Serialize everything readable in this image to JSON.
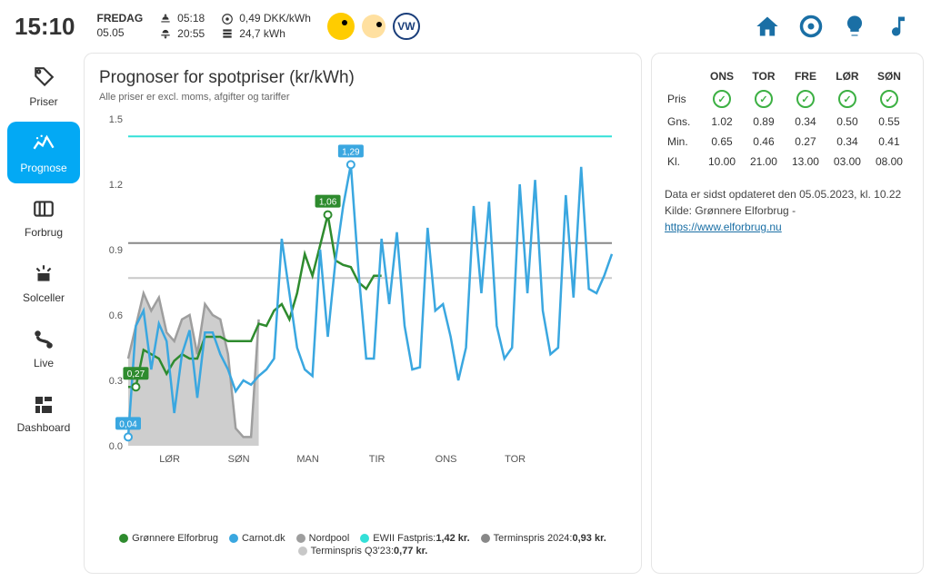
{
  "header": {
    "clock": "15:10",
    "day_name": "FREDAG",
    "date": "05.05",
    "sunrise": "05:18",
    "sunset": "20:55",
    "price_rate": "0,49 DKK/kWh",
    "energy_today": "24,7 kWh"
  },
  "sidebar": {
    "items": [
      {
        "label": "Priser",
        "icon": "tag"
      },
      {
        "label": "Prognose",
        "icon": "sparkline",
        "active": true
      },
      {
        "label": "Forbrug",
        "icon": "counter"
      },
      {
        "label": "Solceller",
        "icon": "solar"
      },
      {
        "label": "Live",
        "icon": "route"
      },
      {
        "label": "Dashboard",
        "icon": "grid"
      }
    ]
  },
  "panel": {
    "title": "Prognoser for spotpriser (kr/kWh)",
    "subtitle": "Alle priser er excl. moms, afgifter og tariffer"
  },
  "legend": [
    {
      "color": "#2e8b2e",
      "label": "Grønnere Elforbrug"
    },
    {
      "color": "#3aa7e0",
      "label": "Carnot.dk"
    },
    {
      "color": "#9e9e9e",
      "label": "Nordpool"
    },
    {
      "color": "#33e0d8",
      "label": "EWII Fastpris:",
      "value": "1,42 kr."
    },
    {
      "color": "#888888",
      "label": "Terminspris 2024:",
      "value": "0,93 kr."
    },
    {
      "color": "#c8c8c8",
      "label": "Terminspris Q3'23:",
      "value": "0,77 kr."
    }
  ],
  "chart_data": {
    "type": "line",
    "title": "Prognoser for spotpriser (kr/kWh)",
    "xlabel": "",
    "ylabel": "",
    "ylim": [
      0,
      1.5
    ],
    "yticks": [
      0.0,
      0.3,
      0.6,
      0.9,
      1.2,
      1.5
    ],
    "x_tick_labels": [
      "LØR",
      "SØN",
      "MAN",
      "TIR",
      "ONS",
      "TOR"
    ],
    "data_labels": [
      {
        "series": "Carnot.dk",
        "x_index": 0,
        "value": 0.04
      },
      {
        "series": "Grønnere Elforbrug",
        "x_index": 1,
        "value": 0.27
      },
      {
        "series": "Grønnere Elforbrug",
        "x_index": 26,
        "value": 1.06
      },
      {
        "series": "Carnot.dk",
        "x_index": 29,
        "value": 1.29
      }
    ],
    "ref_lines": [
      {
        "name": "EWII Fastpris",
        "y": 1.42,
        "color": "#33e0d8"
      },
      {
        "name": "Terminspris 2024",
        "y": 0.93,
        "color": "#888888"
      },
      {
        "name": "Terminspris Q3'23",
        "y": 0.77,
        "color": "#c8c8c8"
      }
    ],
    "series": [
      {
        "name": "Nordpool",
        "color": "#9e9e9e",
        "area": true,
        "values": [
          0.4,
          0.55,
          0.7,
          0.62,
          0.68,
          0.52,
          0.48,
          0.58,
          0.6,
          0.42,
          0.65,
          0.6,
          0.58,
          0.42,
          0.08,
          0.04,
          0.04,
          0.58,
          null,
          null,
          null,
          null,
          null,
          null,
          null,
          null,
          null,
          null,
          null,
          null,
          null,
          null,
          null,
          null,
          null,
          null,
          null,
          null,
          null,
          null,
          null,
          null,
          null,
          null,
          null,
          null,
          null,
          null,
          null,
          null,
          null,
          null,
          null,
          null,
          null,
          null,
          null,
          null,
          null,
          null,
          null,
          null,
          null,
          null
        ]
      },
      {
        "name": "Grønnere Elforbrug",
        "color": "#2e8b2e",
        "values": [
          0.27,
          0.27,
          0.44,
          0.42,
          0.4,
          0.33,
          0.39,
          0.42,
          0.4,
          0.4,
          0.5,
          0.5,
          0.5,
          0.48,
          0.48,
          0.48,
          0.48,
          0.56,
          0.55,
          0.62,
          0.65,
          0.58,
          0.7,
          0.88,
          0.78,
          0.92,
          1.06,
          0.85,
          0.83,
          0.82,
          0.75,
          0.72,
          0.78,
          0.78,
          null,
          null,
          null,
          null,
          null,
          null,
          null,
          null,
          null,
          null,
          null,
          null,
          null,
          null,
          null,
          null,
          null,
          null,
          null,
          null,
          null,
          null,
          null,
          null,
          null,
          null,
          null,
          null,
          null,
          null
        ]
      },
      {
        "name": "Carnot.dk",
        "color": "#3aa7e0",
        "values": [
          0.04,
          0.55,
          0.62,
          0.35,
          0.56,
          0.48,
          0.15,
          0.42,
          0.53,
          0.22,
          0.52,
          0.52,
          0.42,
          0.35,
          0.25,
          0.3,
          0.28,
          0.32,
          0.35,
          0.4,
          0.95,
          0.7,
          0.45,
          0.35,
          0.32,
          0.9,
          0.5,
          0.85,
          1.1,
          1.29,
          0.8,
          0.4,
          0.4,
          0.95,
          0.65,
          0.98,
          0.55,
          0.35,
          0.36,
          1.0,
          0.62,
          0.65,
          0.5,
          0.3,
          0.45,
          1.1,
          0.7,
          1.12,
          0.55,
          0.4,
          0.45,
          1.2,
          0.7,
          1.22,
          0.62,
          0.42,
          0.45,
          1.15,
          0.68,
          1.28,
          0.72,
          0.7,
          0.78,
          0.88
        ]
      }
    ]
  },
  "table": {
    "days": [
      "ONS",
      "TOR",
      "FRE",
      "LØR",
      "SØN"
    ],
    "rows": [
      {
        "label": "Pris",
        "type": "check"
      },
      {
        "label": "Gns.",
        "values": [
          "1.02",
          "0.89",
          "0.34",
          "0.50",
          "0.55"
        ]
      },
      {
        "label": "Min.",
        "values": [
          "0.65",
          "0.46",
          "0.27",
          "0.34",
          "0.41"
        ]
      },
      {
        "label": "Kl.",
        "values": [
          "10.00",
          "21.00",
          "13.00",
          "03.00",
          "08.00"
        ]
      }
    ]
  },
  "info": {
    "updated": "Data er sidst opdateret den 05.05.2023, kl. 10.22",
    "source_label": "Kilde: Grønnere Elforbrug - ",
    "source_link": "https://www.elforbrug.nu"
  }
}
